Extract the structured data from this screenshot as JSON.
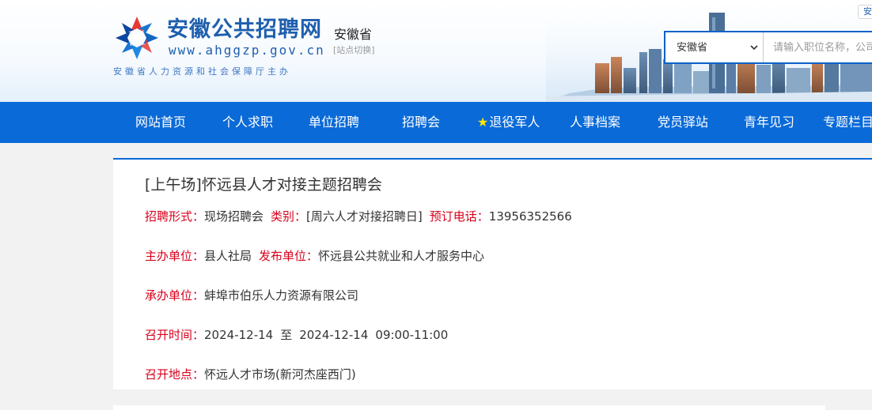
{
  "header": {
    "logo_title": "安徽公共招聘网",
    "logo_url": "www.ahggzp.gov.cn",
    "logo_sub": "安徽省人力资源和社会保障厅主办",
    "site_region": "安徽省",
    "site_switch": "[站点切换]",
    "corner_tab": "安"
  },
  "search": {
    "selected_province": "安徽省",
    "placeholder": "请输入职位名称，公司名称"
  },
  "nav": {
    "items": [
      {
        "label": "网站首页"
      },
      {
        "label": "个人求职"
      },
      {
        "label": "单位招聘"
      },
      {
        "label": "招聘会"
      },
      {
        "label": "退役军人",
        "star": "★"
      },
      {
        "label": "人事档案"
      },
      {
        "label": "党员驿站"
      },
      {
        "label": "青年见习"
      },
      {
        "label": "专题栏目"
      }
    ]
  },
  "fair": {
    "title": "[上午场]怀远县人才对接主题招聘会",
    "form_label": "招聘形式：",
    "form_value": "现场招聘会",
    "category_label": "类别：",
    "category_value": "[周六人才对接招聘日]",
    "phone_label": "预订电话：",
    "phone_value": "13956352566",
    "host_label": "主办单位：",
    "host_value": "县人社局",
    "publisher_label": "发布单位：",
    "publisher_value": "怀远县公共就业和人才服务中心",
    "organizer_label": "承办单位：",
    "organizer_value": "蚌埠市伯乐人力资源有限公司",
    "time_label": "召开时间：",
    "time_start": "2024-12-14",
    "time_to": "至",
    "time_end": "2024-12-14",
    "time_hours": "09:00-11:00",
    "place_label": "召开地点：",
    "place_value": "怀远人才市场(新河杰座西门)"
  },
  "colors": {
    "brand_blue": "#0a6ad8",
    "label_red": "#d9001b",
    "highlight_yellow": "#ffe600"
  }
}
